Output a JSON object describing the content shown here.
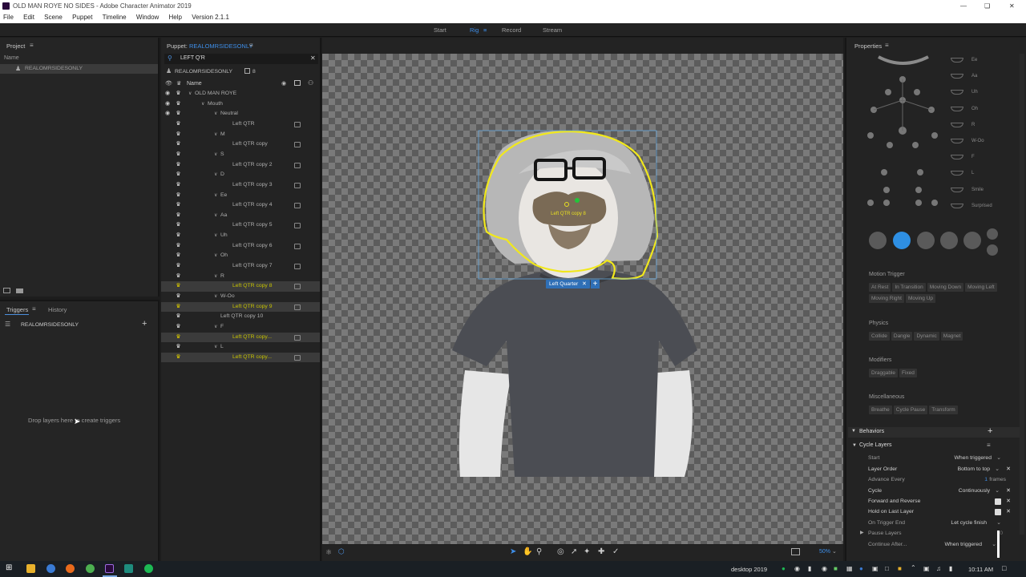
{
  "window": {
    "title": "OLD MAN ROYE NO SIDES - Adobe Character Animator 2019"
  },
  "menu": [
    "File",
    "Edit",
    "Scene",
    "Puppet",
    "Timeline",
    "Window",
    "Help",
    "Version 2.1.1"
  ],
  "modes": {
    "start": "Start",
    "rig": "Rig",
    "record": "Record",
    "stream": "Stream"
  },
  "project": {
    "title": "Project",
    "col_name": "Name",
    "item": "REALOMRSIDESONLY"
  },
  "triggers": {
    "tab_triggers": "Triggers",
    "tab_history": "History",
    "puppet": "REALOMRSIDESONLY",
    "hint": "Drop layers here to create triggers"
  },
  "puppet": {
    "title_prefix": "Puppet:",
    "title_name": "REALOMRSIDESONLY",
    "search": "LEFT Q'R",
    "root": "REALOMRSIDESONLY",
    "root_count": "8",
    "col_name": "Name",
    "rows": [
      {
        "label": "OLD MAN ROYE",
        "indent": 42,
        "chev": true,
        "eye": true
      },
      {
        "label": "Mouth",
        "indent": 58,
        "chev": true,
        "eye": true
      },
      {
        "label": "Neutral",
        "indent": 74,
        "chev": true,
        "eye": true
      },
      {
        "label": "Left QTR",
        "indent": 89,
        "tag": true
      },
      {
        "label": "M",
        "indent": 74,
        "chev": true
      },
      {
        "label": "Left QTR copy",
        "indent": 89,
        "tag": true
      },
      {
        "label": "S",
        "indent": 74,
        "chev": true
      },
      {
        "label": "Left QTR copy 2",
        "indent": 89,
        "tag": true
      },
      {
        "label": "D",
        "indent": 74,
        "chev": true
      },
      {
        "label": "Left QTR copy 3",
        "indent": 89,
        "tag": true
      },
      {
        "label": "Ee",
        "indent": 74,
        "chev": true
      },
      {
        "label": "Left QTR copy 4",
        "indent": 89,
        "tag": true
      },
      {
        "label": "Aa",
        "indent": 74,
        "chev": true
      },
      {
        "label": "Left QTR copy 5",
        "indent": 89,
        "tag": true
      },
      {
        "label": "Uh",
        "indent": 74,
        "chev": true
      },
      {
        "label": "Left QTR copy 6",
        "indent": 89,
        "tag": true
      },
      {
        "label": "Oh",
        "indent": 74,
        "chev": true
      },
      {
        "label": "Left QTR copy 7",
        "indent": 89,
        "tag": true
      },
      {
        "label": "R",
        "indent": 74,
        "chev": true
      },
      {
        "label": "Left QTR copy 8",
        "indent": 89,
        "tag": true,
        "hl": true,
        "sel": true
      },
      {
        "label": "W-Oo",
        "indent": 74,
        "chev": true
      },
      {
        "label": "Left QTR copy 9",
        "indent": 89,
        "tag": true,
        "hl": true,
        "sel": true
      },
      {
        "label": "Left QTR copy 10",
        "indent": 74
      },
      {
        "label": "F",
        "indent": 74,
        "chev": true
      },
      {
        "label": "Left QTR copy...",
        "indent": 89,
        "tag": true,
        "hl": true,
        "sel": true
      },
      {
        "label": "L",
        "indent": 74,
        "chev": true
      },
      {
        "label": "Left QTR copy...",
        "indent": 89,
        "tag": true,
        "hl": true,
        "sel": true
      }
    ]
  },
  "stage": {
    "handle_label": "Left Quarter",
    "mouth_label": "Left QTR copy 8",
    "zoom": "50%"
  },
  "properties": {
    "title": "Properties",
    "visemes": [
      "Ee",
      "Aa",
      "Uh",
      "Oh",
      "R",
      "W-Oo",
      "F",
      "L",
      "Smile",
      "Surprised"
    ],
    "motion_trigger": {
      "title": "Motion Trigger",
      "items": [
        "At Rest",
        "In Transition",
        "Moving Down",
        "Moving Left",
        "Moving Right",
        "Moving Up"
      ]
    },
    "physics": {
      "title": "Physics",
      "items": [
        "Collide",
        "Dangle",
        "Dynamic",
        "Magnet"
      ]
    },
    "modifiers": {
      "title": "Modifiers",
      "items": [
        "Draggable",
        "Fixed"
      ]
    },
    "misc": {
      "title": "Miscellaneous",
      "items": [
        "Breathe",
        "Cycle Pause",
        "Transform"
      ]
    },
    "behaviors": {
      "title": "Behaviors",
      "group": "Cycle Layers",
      "start_label": "Start",
      "start_value": "When triggered",
      "order_label": "Layer Order",
      "order_value": "Bottom to top",
      "advance_label": "Advance Every",
      "advance_num": "1",
      "advance_unit": "frames",
      "cycle_label": "Cycle",
      "cycle_value": "Continuously",
      "fwd_label": "Forward and Reverse",
      "hold_label": "Hold on Last Layer",
      "end_label": "On Trigger End",
      "end_value": "Let cycle finish",
      "pause_label": "Pause Layers",
      "pause_value": "0",
      "continue_label": "Continue After...",
      "continue_value": "When triggered"
    }
  },
  "taskbar": {
    "desktop": "desktop 2019",
    "time": "10:11 AM"
  }
}
